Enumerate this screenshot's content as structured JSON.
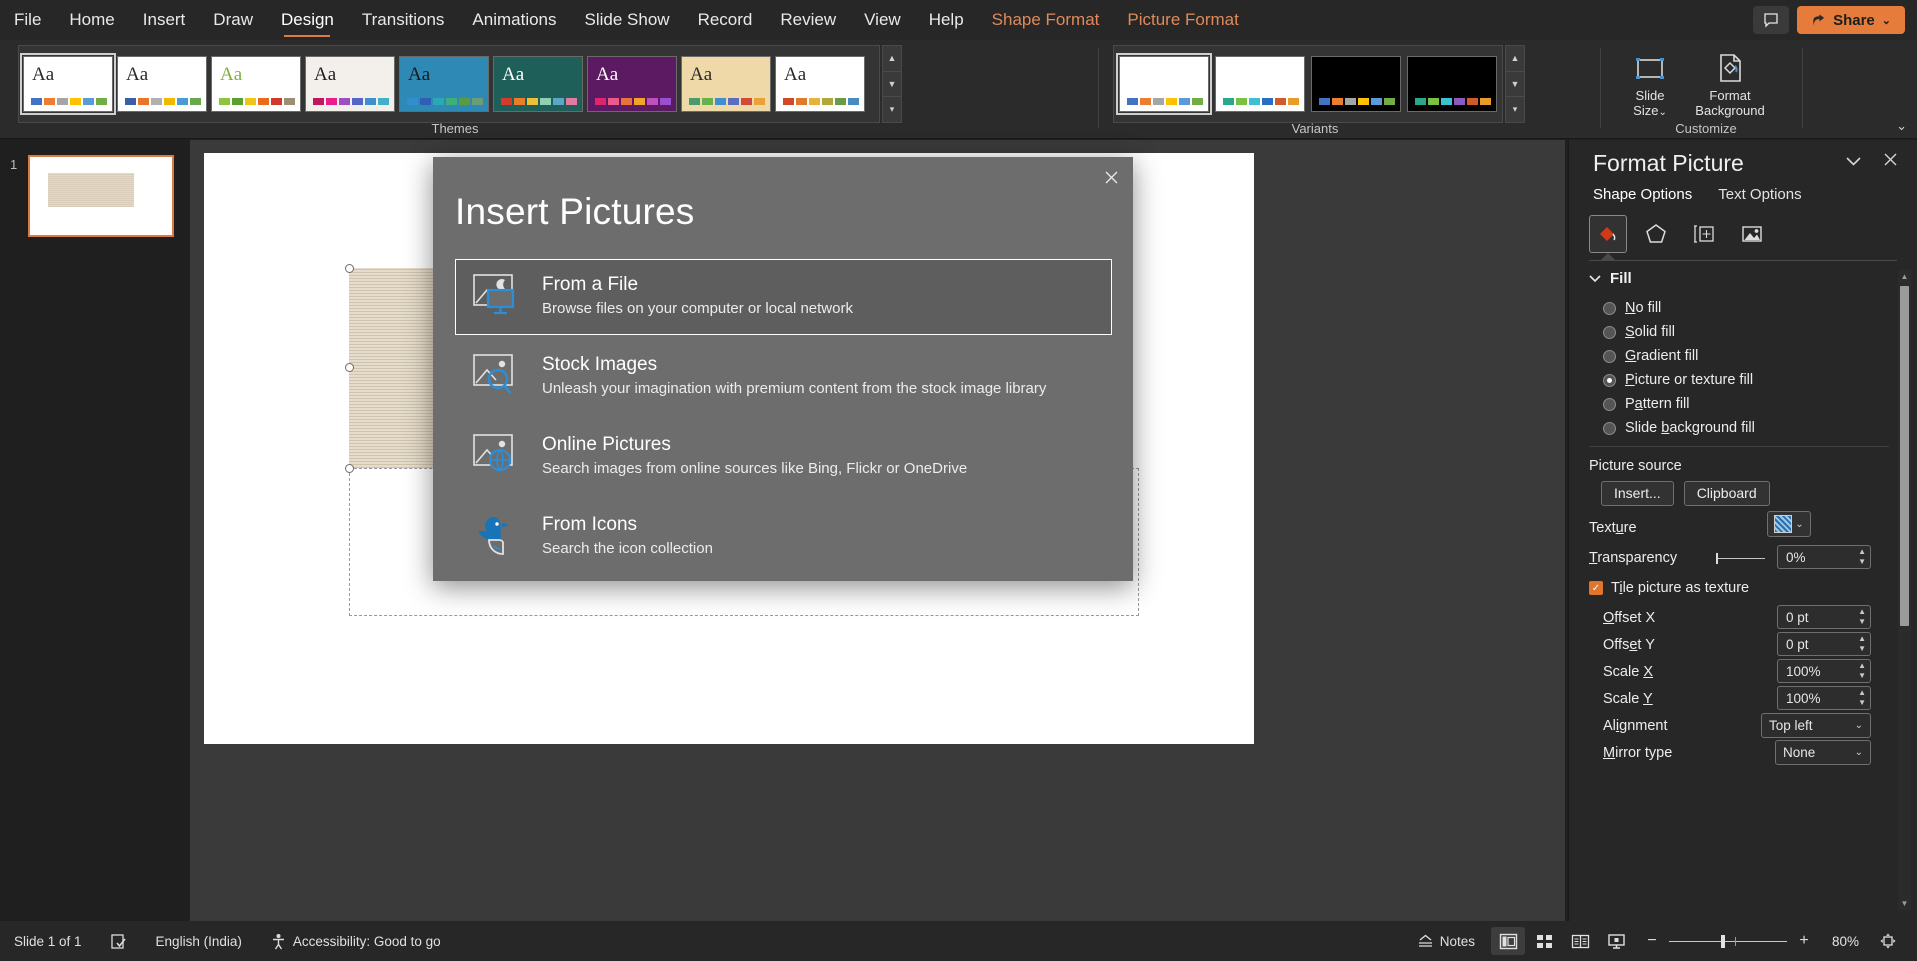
{
  "tabs": [
    {
      "label": "File",
      "state": "normal"
    },
    {
      "label": "Home",
      "state": "normal"
    },
    {
      "label": "Insert",
      "state": "normal"
    },
    {
      "label": "Draw",
      "state": "normal"
    },
    {
      "label": "Design",
      "state": "active"
    },
    {
      "label": "Transitions",
      "state": "normal"
    },
    {
      "label": "Animations",
      "state": "normal"
    },
    {
      "label": "Slide Show",
      "state": "normal"
    },
    {
      "label": "Record",
      "state": "normal"
    },
    {
      "label": "Review",
      "state": "normal"
    },
    {
      "label": "View",
      "state": "normal"
    },
    {
      "label": "Help",
      "state": "normal"
    },
    {
      "label": "Shape Format",
      "state": "contextual"
    },
    {
      "label": "Picture Format",
      "state": "contextual"
    }
  ],
  "titlebar": {
    "comment_icon": "comment-icon",
    "share_label": "Share",
    "share_icon": "share-icon",
    "share_caret": "⌄",
    "share_color": "#e67c3c"
  },
  "ribbon": {
    "collapse_icon": "chevron-up-icon",
    "groups": [
      {
        "name": "Themes",
        "label": "Themes"
      },
      {
        "name": "Variants",
        "label": "Variants"
      },
      {
        "name": "Customize",
        "label": "Customize"
      }
    ],
    "themes": [
      {
        "name": "Office Theme",
        "aa": "Aa",
        "selected": true,
        "bg": "#ffffff",
        "aa_color": "#2a2a2a",
        "swatches": [
          "#4472c4",
          "#ed7d31",
          "#a5a5a5",
          "#ffc000",
          "#5b9bd5",
          "#70ad47"
        ]
      },
      {
        "name": "Berlin",
        "aa": "Aa",
        "selected": false,
        "bg": "#ffffff",
        "aa_color": "#2a2a2a",
        "swatches": [
          "#3b5ea8",
          "#e8752a",
          "#b0b0b0",
          "#f2b800",
          "#4a9ad4",
          "#6aa84f"
        ]
      },
      {
        "name": "Celestial",
        "aa": "Aa",
        "selected": false,
        "bg": "#ffffff",
        "aa_color": "#7fb040",
        "swatches": [
          "#8cc63f",
          "#5aa02c",
          "#f0c419",
          "#ea6a1e",
          "#cf3a2a",
          "#9a8f72"
        ]
      },
      {
        "name": "Circuit",
        "aa": "Aa",
        "selected": false,
        "bg": "#f3f0ec",
        "aa_color": "#1f1f1f",
        "swatches": [
          "#c2185b",
          "#e91e8c",
          "#9b4fc0",
          "#5566c8",
          "#3f8fd0",
          "#43b0c6"
        ]
      },
      {
        "name": "Damask",
        "aa": "Aa",
        "selected": false,
        "bg": "#2e8ab5",
        "aa_color": "#1a1a1a",
        "swatches": [
          "#2f8fd0",
          "#2f5fb5",
          "#2aa8b5",
          "#3fae7a",
          "#5a9b3f",
          "#6a9e78"
        ]
      },
      {
        "name": "Depth",
        "aa": "Aa",
        "selected": false,
        "bg": "#1f5f5a",
        "aa_color": "#ffffff",
        "swatches": [
          "#d63b2a",
          "#ea7c2a",
          "#eec03a",
          "#8fd0b0",
          "#5aa8c6",
          "#e07aa0"
        ]
      },
      {
        "name": "Dividend",
        "aa": "Aa",
        "selected": false,
        "bg": "#5c1a63",
        "aa_color": "#ffffff",
        "swatches": [
          "#e0246e",
          "#ec5a8a",
          "#e8743a",
          "#f0a52a",
          "#c04fc0",
          "#9a4fd0"
        ]
      },
      {
        "name": "Droplet",
        "aa": "Aa",
        "selected": false,
        "bg": "#f0d9a8",
        "aa_color": "#2a2a2a",
        "swatches": [
          "#4a9a6a",
          "#6ab04a",
          "#3f8fd0",
          "#5a6ec0",
          "#d04a3a",
          "#e8a23a"
        ]
      },
      {
        "name": "Facet",
        "aa": "Aa",
        "selected": false,
        "bg": "#ffffff",
        "aa_color": "#2a2a2a",
        "swatches": [
          "#d04a2a",
          "#e07a2a",
          "#e8b23a",
          "#b0a83a",
          "#6a9a4a",
          "#4a8ac0"
        ]
      }
    ],
    "theme_scroll": {
      "up": "▲",
      "down": "▼",
      "more": "▾"
    },
    "variants": [
      {
        "name": "Variant 1",
        "selected": true,
        "bg": "#ffffff",
        "swatches": [
          "#4472c4",
          "#ed7d31",
          "#a5a5a5",
          "#ffc000",
          "#5b9bd5",
          "#70ad47"
        ]
      },
      {
        "name": "Variant 2",
        "selected": false,
        "bg": "#ffffff",
        "swatches": [
          "#2aa88a",
          "#7ac043",
          "#3fc0d0",
          "#2a6ec0",
          "#d05a2a",
          "#e89a2a"
        ]
      },
      {
        "name": "Variant 3",
        "selected": false,
        "bg": "#000000",
        "swatches": [
          "#4472c4",
          "#ed7d31",
          "#a5a5a5",
          "#ffc000",
          "#5b9bd5",
          "#70ad47"
        ]
      },
      {
        "name": "Variant 4",
        "selected": false,
        "bg": "#000000",
        "swatches": [
          "#2aa88a",
          "#7ac043",
          "#3fc0d0",
          "#8a5ac0",
          "#d05a2a",
          "#e89a2a"
        ]
      }
    ],
    "variant_scroll": {
      "up": "▲",
      "down": "▼",
      "more": "▾"
    },
    "customize": {
      "slide_size_label": "Slide\nSize",
      "slide_size_line1": "Slide",
      "slide_size_line2": "Size",
      "slide_size_caret": "⌄",
      "format_background_line1": "Format",
      "format_background_line2": "Background"
    }
  },
  "slide_pane": {
    "slides": [
      {
        "number": "1",
        "selected": true
      }
    ]
  },
  "dialog": {
    "title": "Insert Pictures",
    "close_icon": "close-icon",
    "options": [
      {
        "icon": "picture-monitor-icon",
        "title": "From a File",
        "desc": "Browse files on your computer or local network",
        "focused": true
      },
      {
        "icon": "picture-search-icon",
        "title": "Stock Images",
        "desc": "Unleash your imagination with premium content from the stock image library",
        "focused": false
      },
      {
        "icon": "picture-globe-icon",
        "title": "Online Pictures",
        "desc": "Search images from online sources like Bing, Flickr or OneDrive",
        "focused": false
      },
      {
        "icon": "duck-icon",
        "title": "From Icons",
        "desc": "Search the icon collection",
        "focused": false
      }
    ]
  },
  "format_panel": {
    "title": "Format Picture",
    "collapse_icon": "chevron-down-icon",
    "close_icon": "close-icon",
    "tabs": [
      {
        "label": "Shape Options",
        "active": true
      },
      {
        "label": "Text Options",
        "active": false
      }
    ],
    "category_icons": [
      {
        "name": "fill-line-icon",
        "active": true
      },
      {
        "name": "effects-pentagon-icon",
        "active": false
      },
      {
        "name": "size-properties-icon",
        "active": false
      },
      {
        "name": "picture-icon",
        "active": false
      }
    ],
    "fill_section": {
      "label": "Fill",
      "expand_icon": "chevron-down-icon",
      "options": [
        {
          "label": "No fill",
          "accel": "N",
          "selected": false
        },
        {
          "label": "Solid fill",
          "accel": "S",
          "selected": false
        },
        {
          "label": "Gradient fill",
          "accel": "G",
          "selected": false
        },
        {
          "label": "Picture or texture fill",
          "accel": "P",
          "selected": true
        },
        {
          "label": "Pattern fill",
          "accel": "a",
          "selected": false
        },
        {
          "label": "Slide background fill",
          "accel": "b",
          "selected": false
        }
      ]
    },
    "picture_source": {
      "label": "Picture source",
      "insert_label": "Insert...",
      "clipboard_label": "Clipboard"
    },
    "texture": {
      "label": "Texture",
      "swatch_icon": "texture-swatch-icon",
      "caret": "⌄"
    },
    "transparency": {
      "label": "Transparency",
      "value": "0%"
    },
    "tile": {
      "label": "Tile picture as texture",
      "checked": true
    },
    "fields": [
      {
        "label": "Offset X",
        "value": "0 pt",
        "type": "spin"
      },
      {
        "label": "Offset Y",
        "value": "0 pt",
        "type": "spin"
      },
      {
        "label": "Scale X",
        "value": "100%",
        "type": "spin"
      },
      {
        "label": "Scale Y",
        "value": "100%",
        "type": "spin"
      },
      {
        "label": "Alignment",
        "value": "Top left",
        "type": "combo"
      },
      {
        "label": "Mirror type",
        "value": "None",
        "type": "combo"
      }
    ],
    "scroll": {
      "up": "▲",
      "down": "▼"
    }
  },
  "statusbar": {
    "slide_count": "Slide 1 of 1",
    "spellcheck_icon": "spellcheck-icon",
    "language": "English (India)",
    "accessibility_icon": "accessibility-icon",
    "accessibility": "Accessibility: Good to go",
    "notes_label": "Notes",
    "notes_icon": "notes-caret-icon",
    "views": [
      {
        "name": "normal-view-icon",
        "active": true
      },
      {
        "name": "slide-sorter-icon",
        "active": false
      },
      {
        "name": "reading-view-icon",
        "active": false
      },
      {
        "name": "slideshow-icon",
        "active": false
      }
    ],
    "zoom_out": "−",
    "zoom_in": "+",
    "zoom_level": "80%",
    "fit_icon": "fit-slide-icon"
  }
}
